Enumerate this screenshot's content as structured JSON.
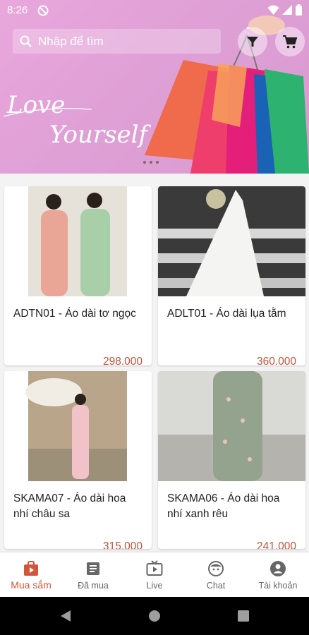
{
  "status_bar": {
    "time": "8:26"
  },
  "search": {
    "placeholder": "Nhập để tìm"
  },
  "banner": {
    "headline_line1": "Love",
    "headline_line2": "Yourself"
  },
  "products": [
    {
      "name": "ADTN01 - Áo dài tơ ngọc",
      "price": "298.000"
    },
    {
      "name": "ADLT01 - Áo dài lụa tằm",
      "price": "360.000"
    },
    {
      "name": "SKAMA07 - Áo dài hoa nhí châu sa",
      "price": "315.000"
    },
    {
      "name": "SKAMA06 - Áo dài hoa nhí xanh rêu",
      "price": "241.000"
    }
  ],
  "bottom_nav": {
    "items": [
      {
        "label": "Mua sắm",
        "icon": "shopping-bag-icon",
        "active": true
      },
      {
        "label": "Đã mua",
        "icon": "receipt-icon",
        "active": false
      },
      {
        "label": "Live",
        "icon": "live-tv-icon",
        "active": false
      },
      {
        "label": "Chat",
        "icon": "chat-face-icon",
        "active": false
      },
      {
        "label": "Tài khoản",
        "icon": "account-icon",
        "active": false
      }
    ]
  },
  "colors": {
    "accent": "#d4553a",
    "price": "#c0543a",
    "banner": "#dfa0d6"
  }
}
